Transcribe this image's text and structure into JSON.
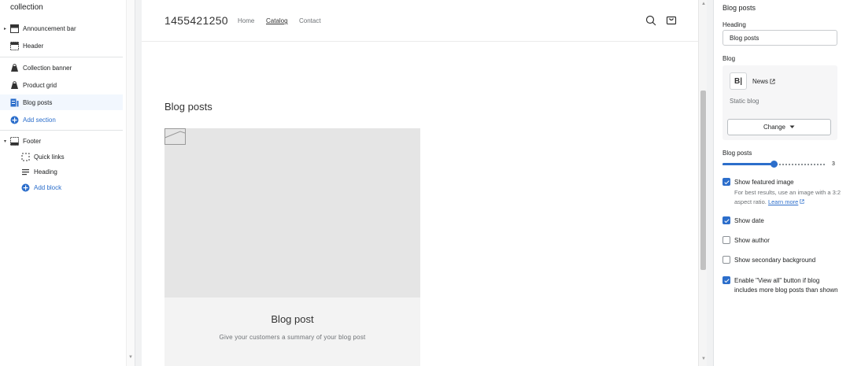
{
  "left": {
    "title": "collection",
    "sections": [
      {
        "label": "Announcement bar",
        "icon": "section-layout-icon",
        "caret": "▸"
      },
      {
        "label": "Header",
        "icon": "header-layout-icon"
      },
      {
        "label": "Collection banner",
        "icon": "collection-icon"
      },
      {
        "label": "Product grid",
        "icon": "product-grid-icon"
      },
      {
        "label": "Blog posts",
        "icon": "blog-icon"
      },
      {
        "label": "Add section",
        "icon": "plus-circle-icon"
      },
      {
        "label": "Footer",
        "icon": "footer-layout-icon",
        "caret": "▾"
      },
      {
        "label": "Quick links",
        "icon": "dashed-frame-icon"
      },
      {
        "label": "Heading",
        "icon": "text-lines-icon"
      },
      {
        "label": "Add block",
        "icon": "plus-circle-icon"
      }
    ]
  },
  "preview": {
    "store_name": "1455421250",
    "nav": [
      "Home",
      "Catalog",
      "Contact"
    ],
    "section_title": "Blog posts",
    "card": {
      "title": "Blog post",
      "summary": "Give your customers a summary of your blog post"
    }
  },
  "right": {
    "title": "Blog posts",
    "heading_label": "Heading",
    "heading_value": "Blog posts",
    "blog_label": "Blog",
    "blog_icon_text": "B|",
    "blog_name": "News",
    "blog_type": "Static blog",
    "change_label": "Change",
    "posts_label": "Blog posts",
    "posts_value": "3",
    "posts_fraction": 0.5,
    "checkboxes": [
      {
        "label": "Show featured image",
        "checked": true,
        "help": "For best results, use an image with a 3:2 aspect ratio.",
        "help_link": "Learn more"
      },
      {
        "label": "Show date",
        "checked": true
      },
      {
        "label": "Show author",
        "checked": false
      },
      {
        "label": "Show secondary background",
        "checked": false
      },
      {
        "label": "Enable \"View all\" button if blog includes more blog posts than shown",
        "checked": true
      }
    ]
  },
  "colors": {
    "accent": "#2c6ecb"
  }
}
